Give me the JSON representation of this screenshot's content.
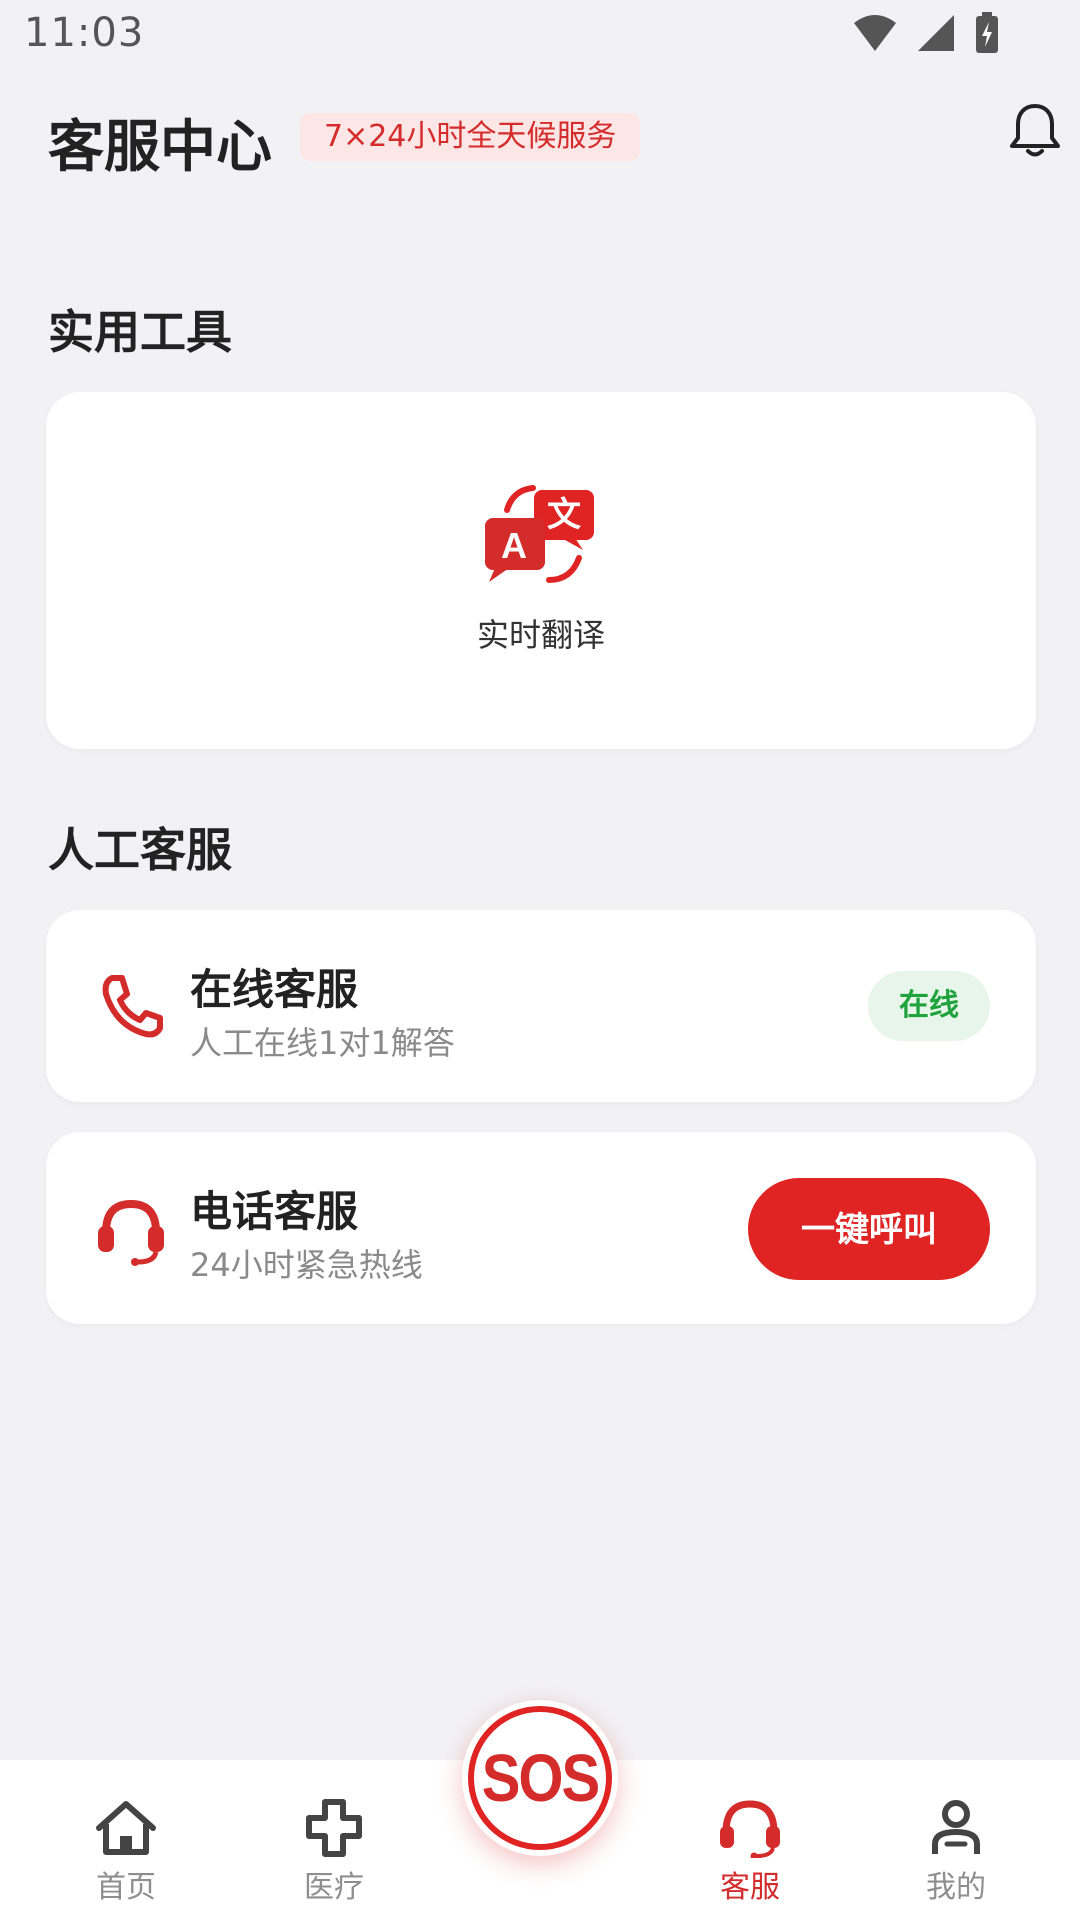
{
  "status_bar": {
    "time": "11:03"
  },
  "header": {
    "title": "客服中心",
    "badge": "7×24小时全天候服务"
  },
  "tools_section": {
    "title": "实用工具",
    "items": [
      {
        "label": "实时翻译",
        "icon": "translate-icon"
      }
    ]
  },
  "human_section": {
    "title": "人工客服",
    "online_service": {
      "title": "在线客服",
      "subtitle": "人工在线1对1解答",
      "status": "在线",
      "icon": "phone-icon"
    },
    "phone_service": {
      "title": "电话客服",
      "subtitle": "24小时紧急热线",
      "button": "一键呼叫",
      "icon": "headset-icon"
    }
  },
  "bottom_nav": {
    "items": [
      {
        "label": "首页",
        "icon": "home-icon"
      },
      {
        "label": "医疗",
        "icon": "medical-cross-icon"
      },
      {
        "label": "客服",
        "icon": "headset-icon",
        "active": true
      },
      {
        "label": "我的",
        "icon": "profile-icon"
      }
    ],
    "sos": "SOS"
  },
  "colors": {
    "accent": "#e02424",
    "online_green": "#1fa33d",
    "background": "#f2f2f5"
  }
}
